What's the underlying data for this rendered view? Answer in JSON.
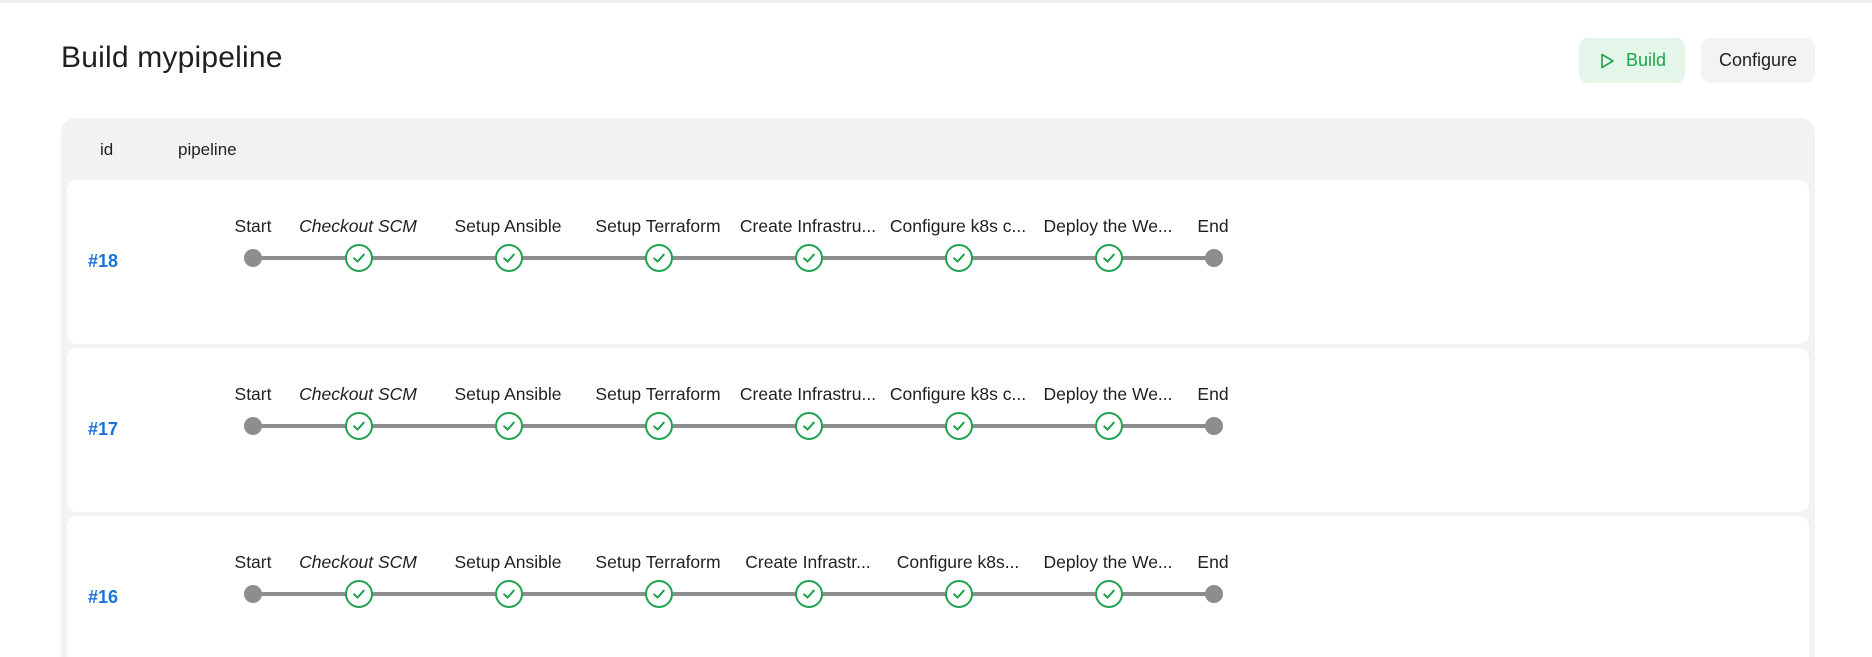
{
  "page": {
    "title": "Build mypipeline",
    "build_label": "Build",
    "configure_label": "Configure"
  },
  "table": {
    "headers": {
      "id": "id",
      "pipeline": "pipeline"
    },
    "runs": [
      {
        "id": "#18",
        "stages": [
          {
            "label": "Start",
            "status": "start"
          },
          {
            "label": "Checkout SCM",
            "status": "success",
            "italic": true
          },
          {
            "label": "Setup Ansible",
            "status": "success"
          },
          {
            "label": "Setup Terraform",
            "status": "success"
          },
          {
            "label": "Create Infrastru...",
            "status": "success"
          },
          {
            "label": "Configure k8s c...",
            "status": "success"
          },
          {
            "label": "Deploy the We...",
            "status": "success"
          },
          {
            "label": "End",
            "status": "end"
          }
        ]
      },
      {
        "id": "#17",
        "stages": [
          {
            "label": "Start",
            "status": "start"
          },
          {
            "label": "Checkout SCM",
            "status": "success",
            "italic": true
          },
          {
            "label": "Setup Ansible",
            "status": "success"
          },
          {
            "label": "Setup Terraform",
            "status": "success"
          },
          {
            "label": "Create Infrastru...",
            "status": "success"
          },
          {
            "label": "Configure k8s c...",
            "status": "success"
          },
          {
            "label": "Deploy the We...",
            "status": "success"
          },
          {
            "label": "End",
            "status": "end"
          }
        ]
      },
      {
        "id": "#16",
        "stages": [
          {
            "label": "Start",
            "status": "start"
          },
          {
            "label": "Checkout SCM",
            "status": "success",
            "italic": true
          },
          {
            "label": "Setup Ansible",
            "status": "success"
          },
          {
            "label": "Setup Terraform",
            "status": "success"
          },
          {
            "label": "Create Infrastr...",
            "status": "success"
          },
          {
            "label": "Configure k8s...",
            "status": "success"
          },
          {
            "label": "Deploy the We...",
            "status": "success"
          },
          {
            "label": "End",
            "status": "end"
          }
        ]
      }
    ]
  },
  "colors": {
    "success": "#21a24f",
    "link": "#1a73d9",
    "track": "#8d8d8d",
    "build_button_bg": "#e4f5e9"
  },
  "icons": {
    "build": "play-icon",
    "success": "check-circle-icon"
  }
}
